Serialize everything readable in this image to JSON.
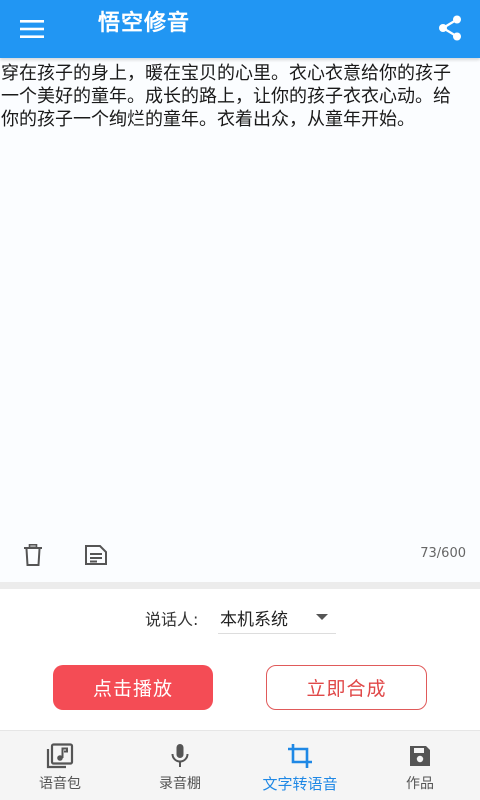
{
  "appbar": {
    "title": "悟空修音",
    "menu_icon": "menu-icon",
    "share_icon": "share-icon",
    "color": "#2196f3"
  },
  "editor": {
    "text": "穿在孩子的身上，暖在宝贝的心里。衣心衣意给你的孩子一个美好的童年。成长的路上，让你的孩子衣衣心动。给你的孩子一个绚烂的童年。衣着出众，从童年开始。",
    "char_count": "73/600",
    "delete_icon": "trash-icon",
    "notes_icon": "notes-icon"
  },
  "speaker": {
    "label": "说话人:",
    "selected": "本机系统"
  },
  "actions": {
    "play_label": "点击播放",
    "synthesize_label": "立即合成",
    "play_color": "#f44c55",
    "synthesize_color": "#e04848"
  },
  "bottom_nav": {
    "active_color": "#1f88e5",
    "items": [
      {
        "label": "语音包",
        "icon": "music-library-icon"
      },
      {
        "label": "录音棚",
        "icon": "microphone-icon"
      },
      {
        "label": "文字转语音",
        "icon": "crop-icon"
      },
      {
        "label": "作品",
        "icon": "save-icon"
      }
    ]
  }
}
